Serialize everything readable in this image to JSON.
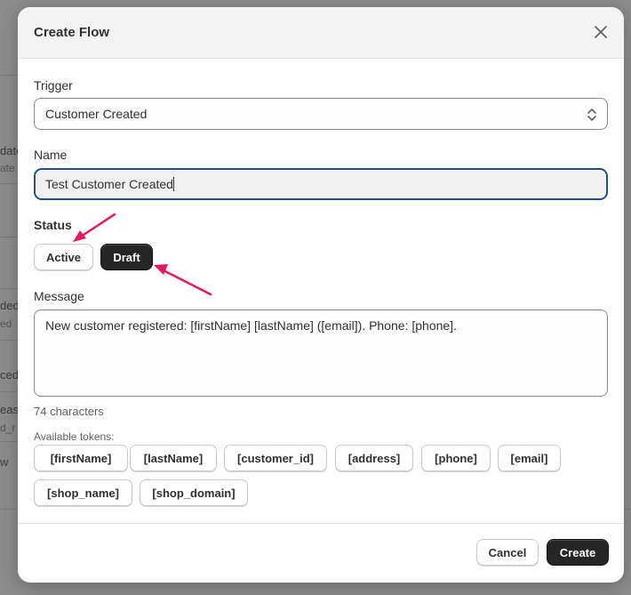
{
  "background": {
    "fragments": [
      "date",
      "ate",
      "ded",
      "ed",
      "ced",
      "eas",
      "d_r",
      "w"
    ]
  },
  "modal": {
    "title": "Create Flow",
    "trigger": {
      "label": "Trigger",
      "value": "Customer Created"
    },
    "name": {
      "label": "Name",
      "value": "Test Customer Created"
    },
    "status": {
      "label": "Status",
      "options": [
        "Active",
        "Draft"
      ],
      "selected": "Draft"
    },
    "message": {
      "label": "Message",
      "value": "New customer registered: [firstName] [lastName] ([email]). Phone: [phone].",
      "char_count": "74 characters"
    },
    "tokens": {
      "label": "Available tokens:",
      "items": [
        "[firstName]",
        "[lastName]",
        "[customer_id]",
        "[address]",
        "[phone]",
        "[email]",
        "[shop_name]",
        "[shop_domain]"
      ]
    },
    "footer": {
      "cancel_label": "Cancel",
      "create_label": "Create"
    }
  },
  "colors": {
    "annotation_arrow": "#e8185e",
    "primary_button": "#262626",
    "focus_border": "#1f4d8c"
  }
}
